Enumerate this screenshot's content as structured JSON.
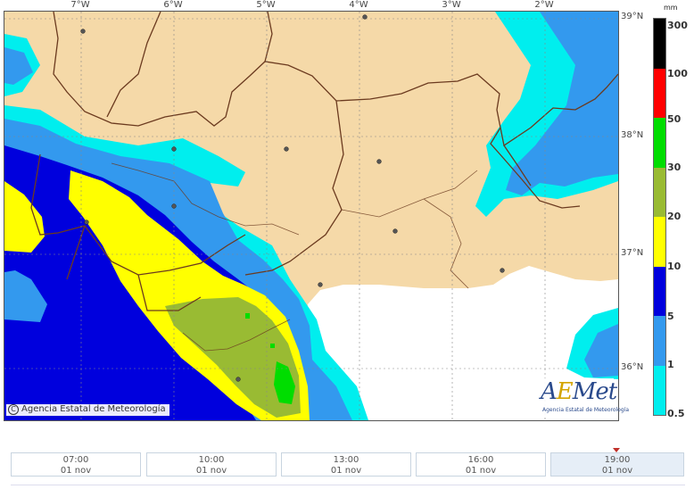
{
  "map": {
    "longitude_labels": [
      "7°W",
      "6°W",
      "5°W",
      "4°W",
      "3°W",
      "2°W"
    ],
    "latitude_labels": [
      "39°N",
      "38°N",
      "37°N",
      "36°N"
    ],
    "copyright": "Agencia Estatal de Meteorología",
    "copyright_symbol": "C"
  },
  "logo": {
    "text_a": "A",
    "text_e": "E",
    "text_rest": "Met",
    "subtitle": "Agencia Estatal de Meteorología"
  },
  "legend": {
    "unit": "mm",
    "levels": [
      {
        "label": "300",
        "color": "#000000"
      },
      {
        "label": "100",
        "color": "#ff0000"
      },
      {
        "label": "50",
        "color": "#00dd00"
      },
      {
        "label": "30",
        "color": "#99bb33"
      },
      {
        "label": "20",
        "color": "#ffff00"
      },
      {
        "label": "10",
        "color": "#0000dd"
      },
      {
        "label": "5",
        "color": "#3399ee"
      },
      {
        "label": "1",
        "color": "#00eeee"
      },
      {
        "label": "0.5",
        "color": ""
      }
    ]
  },
  "colors": {
    "land": "#f5d9a8",
    "sea": "#ffffff",
    "precip_05": "#00eeee",
    "precip_1": "#3399ee",
    "precip_5": "#0000dd",
    "precip_10": "#ffff00",
    "precip_20": "#99bb33",
    "precip_30": "#00dd00",
    "border": "#6b3a1f"
  },
  "timeline": {
    "steps": [
      {
        "time": "07:00",
        "date": "01 nov",
        "active": false
      },
      {
        "time": "10:00",
        "date": "01 nov",
        "active": false
      },
      {
        "time": "13:00",
        "date": "01 nov",
        "active": false
      },
      {
        "time": "16:00",
        "date": "01 nov",
        "active": false
      },
      {
        "time": "19:00",
        "date": "01 nov",
        "active": true
      }
    ]
  }
}
